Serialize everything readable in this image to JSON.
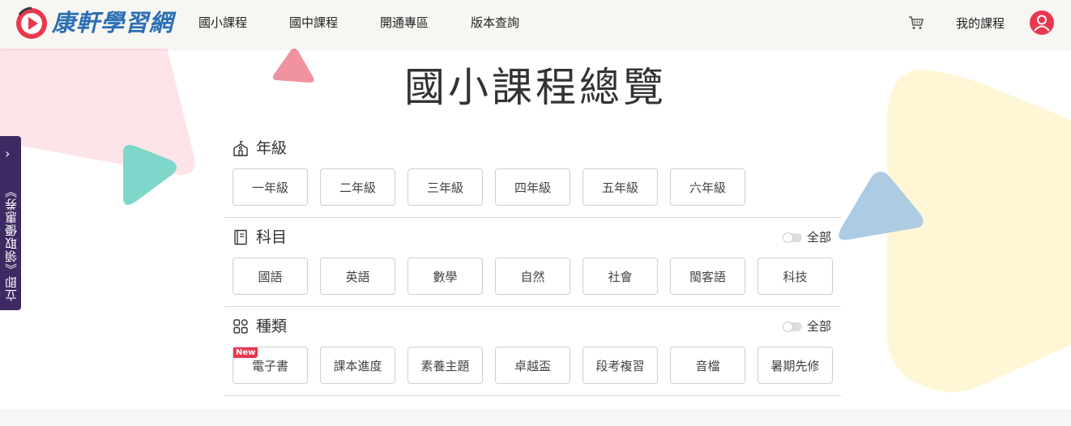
{
  "header": {
    "logo_text": "康軒學習網",
    "nav": [
      "國小課程",
      "國中課程",
      "開通專區",
      "版本查詢"
    ],
    "my_course": "我的課程"
  },
  "side_tab": {
    "label": "立即《領取優惠券》"
  },
  "page_title": "國小課程總覽",
  "filters": {
    "grade": {
      "title": "年級",
      "options": [
        "一年級",
        "二年級",
        "三年級",
        "四年級",
        "五年級",
        "六年級"
      ]
    },
    "subject": {
      "title": "科目",
      "toggle_label": "全部",
      "options": [
        "國語",
        "英語",
        "數學",
        "自然",
        "社會",
        "閩客語",
        "科技"
      ]
    },
    "category": {
      "title": "種類",
      "toggle_label": "全部",
      "badge": "New",
      "options": [
        "電子書",
        "課本進度",
        "素養主題",
        "卓越盃",
        "段考複習",
        "音檔",
        "暑期先修"
      ]
    }
  },
  "colors": {
    "brand_blue": "#2b6fb3",
    "brand_red": "#e8384f",
    "side_tab": "#3e2a63",
    "deco_pink": "#fde4e8",
    "deco_teal": "#7fd6cb",
    "deco_yellow": "#fff6d6",
    "deco_blue": "#a9c8e2"
  },
  "icons": {
    "logo": "play-circle-logo",
    "cart": "cart-icon",
    "avatar": "user-icon",
    "grade": "school-icon",
    "subject": "book-icon",
    "category": "grid-icon",
    "side_tab": "chevron-right-icon"
  }
}
